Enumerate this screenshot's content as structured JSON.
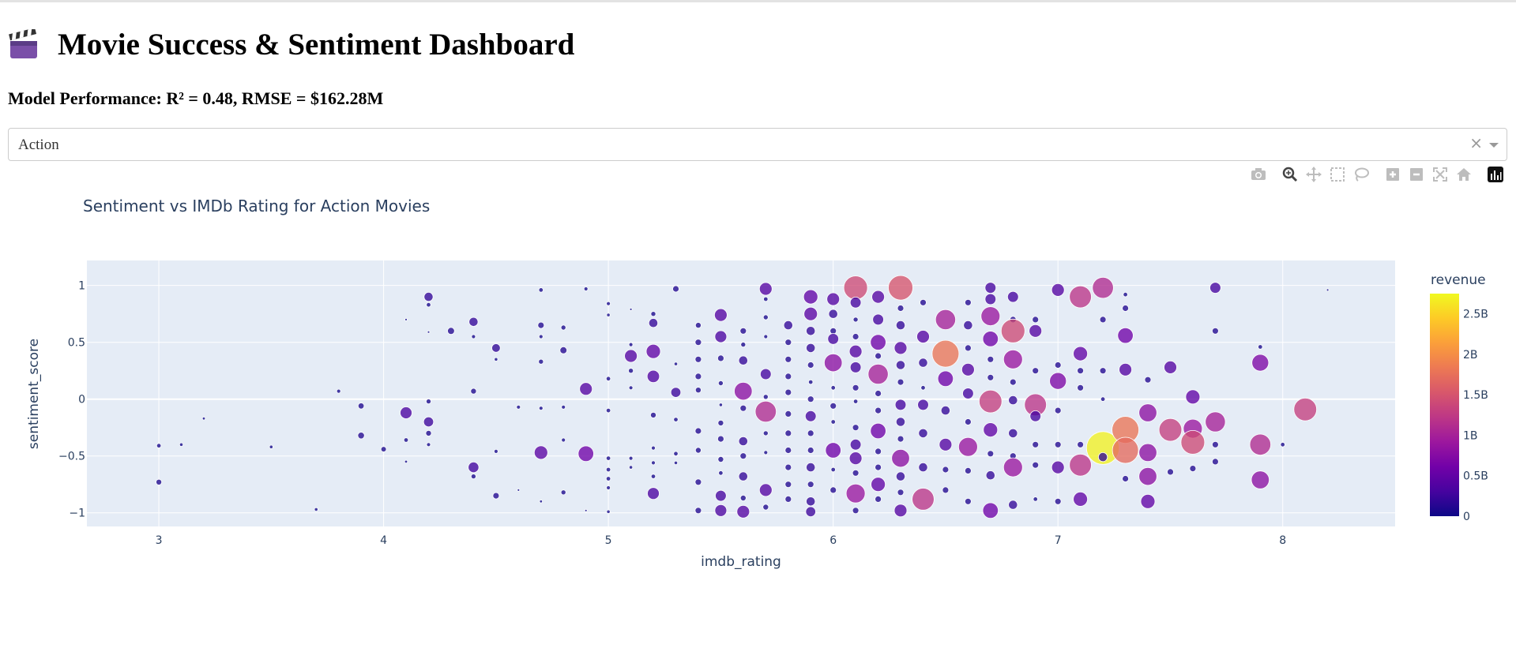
{
  "page": {
    "title": "Movie Success & Sentiment Dashboard",
    "title_icon": "clapperboard-icon",
    "performance": "Model Performance: R² = 0.48, RMSE = $162.28M"
  },
  "dropdown": {
    "value": "Action",
    "clear": "×",
    "clear_icon": "close-icon",
    "arrow_icon": "chevron-down-icon"
  },
  "modebar": {
    "icons": [
      "camera-icon",
      "zoom-icon",
      "pan-icon",
      "box-select-icon",
      "lasso-select-icon",
      "zoom-in-icon",
      "zoom-out-icon",
      "autoscale-icon",
      "reset-axes-icon",
      "plotly-logo-icon"
    ]
  },
  "colors": {
    "plot_bg": "#e5ecf6",
    "text": "#2a3f5f",
    "marker_line": "#ffffff",
    "active_icon": "#444444",
    "inactive_icon": "#bdbdbd"
  },
  "chart_data": {
    "type": "scatter",
    "title": "Sentiment vs IMDb Rating for Action Movies",
    "xlabel": "imdb_rating",
    "ylabel": "sentiment_score",
    "xlim": [
      2.68,
      8.5
    ],
    "ylim": [
      -1.12,
      1.22
    ],
    "xticks": [
      3,
      4,
      5,
      6,
      7,
      8
    ],
    "yticks": [
      -1,
      -0.5,
      0,
      0.5,
      1
    ],
    "ytick_labels": [
      "−1",
      "−0.5",
      "0",
      "0.5",
      "1"
    ],
    "grid": true,
    "marker_size_by": "revenue",
    "colorscale": "plasma",
    "colorbar": {
      "title": "revenue",
      "range": [
        0,
        2.75
      ],
      "unit": "B",
      "ticks": [
        0,
        0.5,
        1,
        1.5,
        2,
        2.5
      ],
      "tick_labels": [
        "0",
        "0.5B",
        "1B",
        "1.5B",
        "2B",
        "2.5B"
      ]
    },
    "points": [
      [
        3.0,
        -0.41,
        0.05
      ],
      [
        3.0,
        -0.73,
        0.08
      ],
      [
        3.1,
        -0.4,
        0.03
      ],
      [
        3.2,
        -0.17,
        0.02
      ],
      [
        3.5,
        -0.42,
        0.03
      ],
      [
        3.7,
        -0.97,
        0.03
      ],
      [
        3.8,
        0.07,
        0.04
      ],
      [
        3.9,
        -0.06,
        0.09
      ],
      [
        3.9,
        -0.32,
        0.11
      ],
      [
        4.0,
        -0.44,
        0.07
      ],
      [
        4.1,
        0.7,
        0.01
      ],
      [
        4.1,
        -0.12,
        0.35
      ],
      [
        4.1,
        -0.36,
        0.05
      ],
      [
        4.1,
        -0.55,
        0.02
      ],
      [
        4.2,
        0.9,
        0.2
      ],
      [
        4.2,
        0.83,
        0.05
      ],
      [
        4.2,
        0.59,
        0.01
      ],
      [
        4.2,
        -0.02,
        0.06
      ],
      [
        4.2,
        -0.2,
        0.25
      ],
      [
        4.2,
        -0.3,
        0.08
      ],
      [
        4.2,
        -0.4,
        0.04
      ],
      [
        4.3,
        0.6,
        0.12
      ],
      [
        4.4,
        0.68,
        0.2
      ],
      [
        4.4,
        0.55,
        0.04
      ],
      [
        4.4,
        0.07,
        0.08
      ],
      [
        4.4,
        -0.6,
        0.28
      ],
      [
        4.4,
        -0.68,
        0.06
      ],
      [
        4.5,
        0.45,
        0.18
      ],
      [
        4.5,
        0.35,
        0.03
      ],
      [
        4.5,
        -0.46,
        0.04
      ],
      [
        4.5,
        -0.85,
        0.1
      ],
      [
        4.6,
        -0.8,
        0.01
      ],
      [
        4.6,
        -0.07,
        0.04
      ],
      [
        4.7,
        0.96,
        0.05
      ],
      [
        4.7,
        0.65,
        0.1
      ],
      [
        4.7,
        0.55,
        0.04
      ],
      [
        4.7,
        0.33,
        0.06
      ],
      [
        4.7,
        -0.08,
        0.04
      ],
      [
        4.7,
        -0.47,
        0.45
      ],
      [
        4.7,
        -0.9,
        0.02
      ],
      [
        4.8,
        0.63,
        0.06
      ],
      [
        4.8,
        0.43,
        0.12
      ],
      [
        4.8,
        -0.07,
        0.04
      ],
      [
        4.8,
        -0.36,
        0.04
      ],
      [
        4.8,
        -0.82,
        0.06
      ],
      [
        4.9,
        0.97,
        0.04
      ],
      [
        4.9,
        0.09,
        0.4
      ],
      [
        4.9,
        -0.48,
        0.6
      ],
      [
        4.9,
        -0.98,
        0.01
      ],
      [
        5.0,
        0.84,
        0.04
      ],
      [
        5.0,
        0.74,
        0.03
      ],
      [
        5.0,
        0.18,
        0.05
      ],
      [
        5.0,
        -0.1,
        0.05
      ],
      [
        5.0,
        -0.52,
        0.05
      ],
      [
        5.0,
        -0.62,
        0.05
      ],
      [
        5.0,
        -0.7,
        0.05
      ],
      [
        5.0,
        -0.78,
        0.04
      ],
      [
        5.0,
        -0.99,
        0.03
      ],
      [
        5.1,
        0.79,
        0.01
      ],
      [
        5.1,
        0.48,
        0.04
      ],
      [
        5.1,
        0.38,
        0.4
      ],
      [
        5.1,
        0.25,
        0.06
      ],
      [
        5.1,
        0.1,
        0.04
      ],
      [
        5.1,
        -0.52,
        0.04
      ],
      [
        5.1,
        -0.6,
        0.03
      ],
      [
        5.2,
        0.75,
        0.06
      ],
      [
        5.2,
        0.67,
        0.2
      ],
      [
        5.2,
        0.42,
        0.5
      ],
      [
        5.2,
        0.2,
        0.38
      ],
      [
        5.2,
        -0.14,
        0.08
      ],
      [
        5.2,
        -0.43,
        0.04
      ],
      [
        5.2,
        -0.56,
        0.04
      ],
      [
        5.2,
        -0.68,
        0.05
      ],
      [
        5.2,
        -0.83,
        0.35
      ],
      [
        5.3,
        0.97,
        0.1
      ],
      [
        5.3,
        0.31,
        0.03
      ],
      [
        5.3,
        0.06,
        0.25
      ],
      [
        5.3,
        -0.18,
        0.05
      ],
      [
        5.3,
        -0.48,
        0.05
      ],
      [
        5.3,
        -0.56,
        0.03
      ],
      [
        5.4,
        0.65,
        0.08
      ],
      [
        5.4,
        0.5,
        0.1
      ],
      [
        5.4,
        0.35,
        0.1
      ],
      [
        5.4,
        0.2,
        0.1
      ],
      [
        5.4,
        0.08,
        0.08
      ],
      [
        5.4,
        -0.28,
        0.1
      ],
      [
        5.4,
        -0.45,
        0.08
      ],
      [
        5.4,
        -0.73,
        0.1
      ],
      [
        5.4,
        -0.98,
        0.1
      ],
      [
        5.5,
        0.74,
        0.4
      ],
      [
        5.5,
        0.55,
        0.35
      ],
      [
        5.5,
        0.36,
        0.1
      ],
      [
        5.5,
        0.14,
        0.06
      ],
      [
        5.5,
        -0.05,
        0.03
      ],
      [
        5.5,
        -0.21,
        0.08
      ],
      [
        5.5,
        -0.35,
        0.1
      ],
      [
        5.5,
        -0.53,
        0.08
      ],
      [
        5.5,
        -0.65,
        0.05
      ],
      [
        5.5,
        -0.85,
        0.3
      ],
      [
        5.5,
        -0.98,
        0.35
      ],
      [
        5.6,
        0.6,
        0.1
      ],
      [
        5.6,
        0.48,
        0.06
      ],
      [
        5.6,
        0.34,
        0.2
      ],
      [
        5.6,
        0.07,
        0.8
      ],
      [
        5.6,
        -0.08,
        0.1
      ],
      [
        5.6,
        -0.37,
        0.2
      ],
      [
        5.6,
        -0.5,
        0.1
      ],
      [
        5.6,
        -0.68,
        0.2
      ],
      [
        5.6,
        -0.87,
        0.08
      ],
      [
        5.6,
        -0.99,
        0.4
      ],
      [
        5.7,
        0.97,
        0.4
      ],
      [
        5.7,
        0.88,
        0.05
      ],
      [
        5.7,
        0.72,
        0.06
      ],
      [
        5.7,
        0.55,
        0.04
      ],
      [
        5.7,
        0.22,
        0.3
      ],
      [
        5.7,
        0.02,
        0.06
      ],
      [
        5.7,
        -0.11,
        1.1
      ],
      [
        5.7,
        -0.3,
        0.06
      ],
      [
        5.7,
        -0.47,
        0.04
      ],
      [
        5.7,
        -0.8,
        0.4
      ],
      [
        5.7,
        -0.95,
        0.08
      ],
      [
        5.8,
        0.65,
        0.2
      ],
      [
        5.8,
        0.5,
        0.1
      ],
      [
        5.8,
        0.35,
        0.1
      ],
      [
        5.8,
        0.2,
        0.1
      ],
      [
        5.8,
        0.06,
        0.1
      ],
      [
        5.8,
        -0.13,
        0.1
      ],
      [
        5.8,
        -0.3,
        0.1
      ],
      [
        5.8,
        -0.45,
        0.1
      ],
      [
        5.8,
        -0.6,
        0.1
      ],
      [
        5.8,
        -0.75,
        0.1
      ],
      [
        5.8,
        -0.88,
        0.1
      ],
      [
        5.9,
        0.9,
        0.5
      ],
      [
        5.9,
        0.75,
        0.45
      ],
      [
        5.9,
        0.6,
        0.2
      ],
      [
        5.9,
        0.45,
        0.2
      ],
      [
        5.9,
        0.3,
        0.1
      ],
      [
        5.9,
        0.15,
        0.05
      ],
      [
        5.9,
        0.0,
        0.1
      ],
      [
        5.9,
        -0.15,
        0.3
      ],
      [
        5.9,
        -0.3,
        0.1
      ],
      [
        5.9,
        -0.45,
        0.1
      ],
      [
        5.9,
        -0.6,
        0.2
      ],
      [
        5.9,
        -0.75,
        0.1
      ],
      [
        5.9,
        -0.9,
        0.2
      ],
      [
        5.9,
        -0.99,
        0.25
      ],
      [
        6.0,
        0.88,
        0.4
      ],
      [
        6.0,
        0.75,
        0.2
      ],
      [
        6.0,
        0.6,
        0.1
      ],
      [
        6.0,
        0.53,
        0.3
      ],
      [
        6.0,
        0.32,
        0.8
      ],
      [
        6.0,
        0.1,
        0.05
      ],
      [
        6.0,
        -0.06,
        0.1
      ],
      [
        6.0,
        -0.2,
        0.05
      ],
      [
        6.0,
        -0.45,
        0.6
      ],
      [
        6.0,
        -0.62,
        0.05
      ],
      [
        6.0,
        -0.8,
        0.1
      ],
      [
        6.1,
        0.98,
        1.4
      ],
      [
        6.1,
        0.85,
        0.3
      ],
      [
        6.1,
        0.7,
        0.06
      ],
      [
        6.1,
        0.55,
        0.1
      ],
      [
        6.1,
        0.42,
        0.4
      ],
      [
        6.1,
        0.28,
        0.3
      ],
      [
        6.1,
        0.1,
        0.1
      ],
      [
        6.1,
        -0.02,
        0.05
      ],
      [
        6.1,
        -0.25,
        0.1
      ],
      [
        6.1,
        -0.4,
        0.3
      ],
      [
        6.1,
        -0.52,
        0.4
      ],
      [
        6.1,
        -0.65,
        0.1
      ],
      [
        6.1,
        -0.83,
        0.9
      ],
      [
        6.1,
        -0.98,
        0.1
      ],
      [
        6.2,
        0.9,
        0.4
      ],
      [
        6.2,
        0.7,
        0.3
      ],
      [
        6.2,
        0.5,
        0.6
      ],
      [
        6.2,
        0.38,
        0.1
      ],
      [
        6.2,
        0.22,
        1.0
      ],
      [
        6.2,
        0.05,
        0.1
      ],
      [
        6.2,
        -0.1,
        0.1
      ],
      [
        6.2,
        -0.28,
        0.6
      ],
      [
        6.2,
        -0.46,
        0.1
      ],
      [
        6.2,
        -0.6,
        0.1
      ],
      [
        6.2,
        -0.75,
        0.5
      ],
      [
        6.2,
        -0.88,
        0.1
      ],
      [
        6.3,
        0.98,
        1.5
      ],
      [
        6.3,
        0.8,
        0.1
      ],
      [
        6.3,
        0.65,
        0.2
      ],
      [
        6.3,
        0.45,
        0.4
      ],
      [
        6.3,
        0.3,
        0.2
      ],
      [
        6.3,
        0.15,
        0.1
      ],
      [
        6.3,
        -0.05,
        0.3
      ],
      [
        6.3,
        -0.2,
        0.2
      ],
      [
        6.3,
        -0.35,
        0.1
      ],
      [
        6.3,
        -0.52,
        0.8
      ],
      [
        6.3,
        -0.68,
        0.2
      ],
      [
        6.3,
        -0.82,
        0.1
      ],
      [
        6.3,
        -0.98,
        0.4
      ],
      [
        6.4,
        0.85,
        0.1
      ],
      [
        6.4,
        0.55,
        0.4
      ],
      [
        6.4,
        0.32,
        0.2
      ],
      [
        6.4,
        0.1,
        0.05
      ],
      [
        6.4,
        -0.05,
        0.3
      ],
      [
        6.4,
        -0.3,
        0.2
      ],
      [
        6.4,
        -0.6,
        0.2
      ],
      [
        6.4,
        -0.88,
        1.2
      ],
      [
        6.5,
        0.7,
        1.0
      ],
      [
        6.5,
        0.4,
        1.8
      ],
      [
        6.5,
        0.18,
        0.6
      ],
      [
        6.5,
        -0.1,
        0.2
      ],
      [
        6.5,
        -0.4,
        0.4
      ],
      [
        6.5,
        -0.62,
        0.1
      ],
      [
        6.5,
        -0.8,
        0.1
      ],
      [
        6.6,
        0.85,
        0.1
      ],
      [
        6.6,
        0.65,
        0.2
      ],
      [
        6.6,
        0.45,
        0.1
      ],
      [
        6.6,
        0.26,
        0.4
      ],
      [
        6.6,
        0.05,
        0.3
      ],
      [
        6.6,
        -0.2,
        0.1
      ],
      [
        6.6,
        -0.42,
        0.9
      ],
      [
        6.6,
        -0.63,
        0.1
      ],
      [
        6.6,
        -0.9,
        0.1
      ],
      [
        6.7,
        0.98,
        0.3
      ],
      [
        6.7,
        0.88,
        0.3
      ],
      [
        6.7,
        0.73,
        0.9
      ],
      [
        6.7,
        0.53,
        0.6
      ],
      [
        6.7,
        0.35,
        0.1
      ],
      [
        6.7,
        0.19,
        0.1
      ],
      [
        6.7,
        -0.02,
        1.3
      ],
      [
        6.7,
        -0.27,
        0.5
      ],
      [
        6.7,
        -0.48,
        0.1
      ],
      [
        6.7,
        -0.67,
        0.2
      ],
      [
        6.7,
        -0.98,
        0.6
      ],
      [
        6.8,
        0.9,
        0.3
      ],
      [
        6.8,
        0.7,
        0.1
      ],
      [
        6.8,
        0.6,
        1.4
      ],
      [
        6.8,
        0.35,
        0.9
      ],
      [
        6.8,
        0.15,
        0.1
      ],
      [
        6.8,
        -0.01,
        0.2
      ],
      [
        6.8,
        -0.3,
        0.2
      ],
      [
        6.8,
        -0.5,
        0.1
      ],
      [
        6.8,
        -0.6,
        0.9
      ],
      [
        6.8,
        -0.93,
        0.2
      ],
      [
        6.9,
        0.7,
        0.1
      ],
      [
        6.9,
        0.6,
        0.4
      ],
      [
        6.9,
        0.25,
        0.1
      ],
      [
        6.9,
        -0.05,
        1.2
      ],
      [
        6.9,
        -0.15,
        0.3
      ],
      [
        6.9,
        -0.4,
        0.1
      ],
      [
        6.9,
        -0.58,
        0.1
      ],
      [
        6.9,
        -0.88,
        0.05
      ],
      [
        7.0,
        0.96,
        0.4
      ],
      [
        7.0,
        0.3,
        0.1
      ],
      [
        7.0,
        0.16,
        0.7
      ],
      [
        7.0,
        -0.1,
        0.1
      ],
      [
        7.0,
        -0.4,
        0.1
      ],
      [
        7.0,
        -0.6,
        0.4
      ],
      [
        7.0,
        -0.9,
        0.1
      ],
      [
        7.1,
        0.9,
        1.2
      ],
      [
        7.1,
        0.4,
        0.5
      ],
      [
        7.1,
        0.25,
        0.1
      ],
      [
        7.1,
        0.1,
        0.1
      ],
      [
        7.1,
        -0.4,
        0.1
      ],
      [
        7.1,
        -0.58,
        1.2
      ],
      [
        7.1,
        -0.88,
        0.5
      ],
      [
        7.2,
        0.98,
        1.1
      ],
      [
        7.2,
        0.7,
        0.1
      ],
      [
        7.2,
        0.25,
        0.1
      ],
      [
        7.2,
        0.0,
        0.05
      ],
      [
        7.2,
        -0.43,
        2.7
      ],
      [
        7.2,
        -0.51,
        0.2
      ],
      [
        7.3,
        0.92,
        0.05
      ],
      [
        7.3,
        0.8,
        0.1
      ],
      [
        7.3,
        0.56,
        0.6
      ],
      [
        7.3,
        0.26,
        0.4
      ],
      [
        7.3,
        -0.27,
        1.8
      ],
      [
        7.3,
        -0.45,
        1.7
      ],
      [
        7.3,
        -0.7,
        0.1
      ],
      [
        7.4,
        0.17,
        0.1
      ],
      [
        7.4,
        -0.12,
        0.8
      ],
      [
        7.4,
        -0.47,
        0.8
      ],
      [
        7.4,
        -0.68,
        0.8
      ],
      [
        7.4,
        -0.9,
        0.5
      ],
      [
        7.5,
        0.28,
        0.4
      ],
      [
        7.5,
        -0.27,
        1.3
      ],
      [
        7.5,
        -0.64,
        0.1
      ],
      [
        7.6,
        0.02,
        0.5
      ],
      [
        7.6,
        -0.26,
        0.9
      ],
      [
        7.6,
        -0.38,
        1.4
      ],
      [
        7.6,
        -0.61,
        0.1
      ],
      [
        7.7,
        0.98,
        0.3
      ],
      [
        7.7,
        0.6,
        0.1
      ],
      [
        7.7,
        -0.2,
        1.0
      ],
      [
        7.7,
        -0.4,
        0.1
      ],
      [
        7.7,
        -0.55,
        0.1
      ],
      [
        7.9,
        0.46,
        0.05
      ],
      [
        7.9,
        0.32,
        0.7
      ],
      [
        7.9,
        -0.4,
        1.1
      ],
      [
        7.9,
        -0.71,
        0.8
      ],
      [
        8.0,
        -0.4,
        0.05
      ],
      [
        8.1,
        -0.09,
        1.3
      ],
      [
        8.2,
        0.96,
        0.01
      ]
    ]
  }
}
